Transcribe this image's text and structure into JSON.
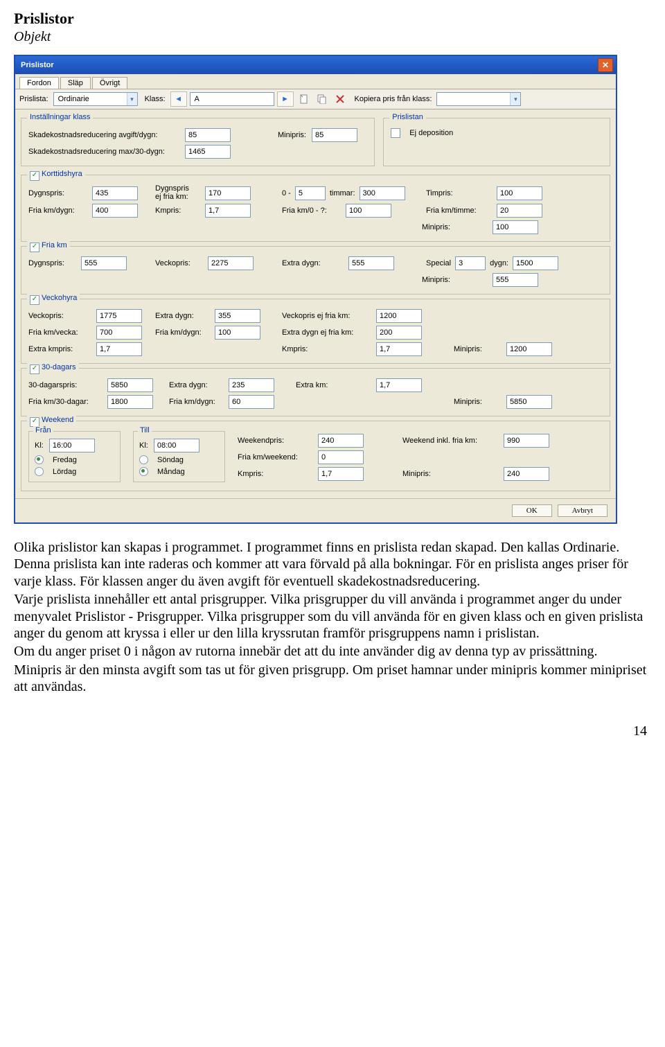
{
  "page": {
    "title": "Prislistor",
    "subtitle": "Objekt",
    "number": "14"
  },
  "window": {
    "title": "Prislistor"
  },
  "tabs": [
    "Fordon",
    "Släp",
    "Övrigt"
  ],
  "toolbar": {
    "prislista_lbl": "Prislista:",
    "prislista_val": "Ordinarie",
    "klass_lbl": "Klass:",
    "klass_val": "A",
    "kopiera_lbl": "Kopiera pris från klass:"
  },
  "inst": {
    "legend": "Inställningar klass",
    "reduc_lbl": "Skadekostnadsreducering avgift/dygn:",
    "reduc_val": "85",
    "mini_lbl": "Minipris:",
    "mini_val": "85",
    "max_lbl": "Skadekostnadsreducering max/30-dygn:",
    "max_val": "1465"
  },
  "prislistan": {
    "legend": "Prislistan",
    "ej_lbl": "Ej deposition"
  },
  "kortt": {
    "legend": "Korttidshyra",
    "dygnspris_lbl": "Dygnspris:",
    "dygnspris": "435",
    "dygnspris_ej_lbl": "Dygnspris\nej fria km:",
    "dygnspris_ej": "170",
    "nolldash": "0 -",
    "timmar_lbl": "timmar:",
    "hours": "5",
    "timval": "300",
    "timpris_lbl": "Timpris:",
    "timpris": "100",
    "friakmdygn_lbl": "Fria km/dygn:",
    "friakmdygn": "400",
    "kmpris_lbl": "Kmpris:",
    "kmpris": "1,7",
    "friakm0_lbl": "Fria km/0 - ?:",
    "friakm0": "100",
    "friakmtimme_lbl": "Fria km/timme:",
    "friakmtimme": "20",
    "mini_lbl": "Minipris:",
    "mini": "100"
  },
  "friakm": {
    "legend": "Fria km",
    "dygn_lbl": "Dygnspris:",
    "dygn": "555",
    "vecko_lbl": "Veckopris:",
    "vecko": "2275",
    "extra_lbl": "Extra dygn:",
    "extra": "555",
    "special_lbl": "Special",
    "special_n": "3",
    "special_dygn": "dygn:",
    "special_v": "1500",
    "mini_lbl": "Minipris:",
    "mini": "555"
  },
  "veckohyra": {
    "legend": "Veckohyra",
    "vecko_lbl": "Veckopris:",
    "vecko": "1775",
    "extra_lbl": "Extra dygn:",
    "extra": "355",
    "veckoej_lbl": "Veckopris ej fria km:",
    "veckoej": "1200",
    "friakmvecka_lbl": "Fria km/vecka:",
    "friakmvecka": "700",
    "friakmdygn_lbl": "Fria km/dygn:",
    "friakmdygn": "100",
    "extradygnej_lbl": "Extra dygn ej fria km:",
    "extradygnej": "200",
    "extrakmpris_lbl": "Extra kmpris:",
    "extrakmpris": "1,7",
    "kmpris_lbl": "Kmpris:",
    "kmpris": "1,7",
    "mini_lbl": "Minipris:",
    "mini": "1200"
  },
  "tretti": {
    "legend": "30-dagars",
    "pris_lbl": "30-dagarspris:",
    "pris": "5850",
    "extra_lbl": "Extra dygn:",
    "extra": "235",
    "extrakm_lbl": "Extra km:",
    "extrakm": "1,7",
    "friakm30_lbl": "Fria km/30-dagar:",
    "friakm30": "1800",
    "friakmdygn_lbl": "Fria km/dygn:",
    "friakmdygn": "60",
    "mini_lbl": "Minipris:",
    "mini": "5850"
  },
  "weekend": {
    "legend": "Weekend",
    "from_legend": "Från",
    "to_legend": "Till",
    "kl_lbl": "Kl:",
    "from_time": "16:00",
    "to_time": "08:00",
    "fredag": "Fredag",
    "lordag": "Lördag",
    "sondag": "Söndag",
    "mandag": "Måndag",
    "wp_lbl": "Weekendpris:",
    "wp": "240",
    "winkl_lbl": "Weekend inkl. fria km:",
    "winkl": "990",
    "fkmw_lbl": "Fria km/weekend:",
    "fkmw": "0",
    "kmpris_lbl": "Kmpris:",
    "kmpris": "1,7",
    "mini_lbl": "Minipris:",
    "mini": "240"
  },
  "buttons": {
    "ok": "OK",
    "cancel": "Avbryt"
  },
  "para": {
    "p1": "Olika prislistor kan skapas i programmet. I programmet finns en prislista redan skapad. Den kallas Ordinarie. Denna prislista kan inte raderas och kommer att vara förvald på alla bokningar. För en prislista anges priser för varje klass. För klassen anger du även avgift för eventuell skadekostnadsreducering.",
    "p2": "Varje prislista innehåller ett antal prisgrupper. Vilka prisgrupper du vill använda i programmet anger du under menyvalet Prislistor - Prisgrupper. Vilka prisgrupper som du vill använda för en given klass och en given prislista anger du genom att kryssa i eller ur den lilla kryssrutan framför prisgruppens namn i prislistan.",
    "p3": "Om du anger priset 0 i någon av rutorna innebär det att du inte använder dig av denna typ av prissättning.",
    "p4": "Minipris är den minsta avgift som tas ut för given prisgrupp. Om priset hamnar under minipris kommer minipriset att användas."
  }
}
